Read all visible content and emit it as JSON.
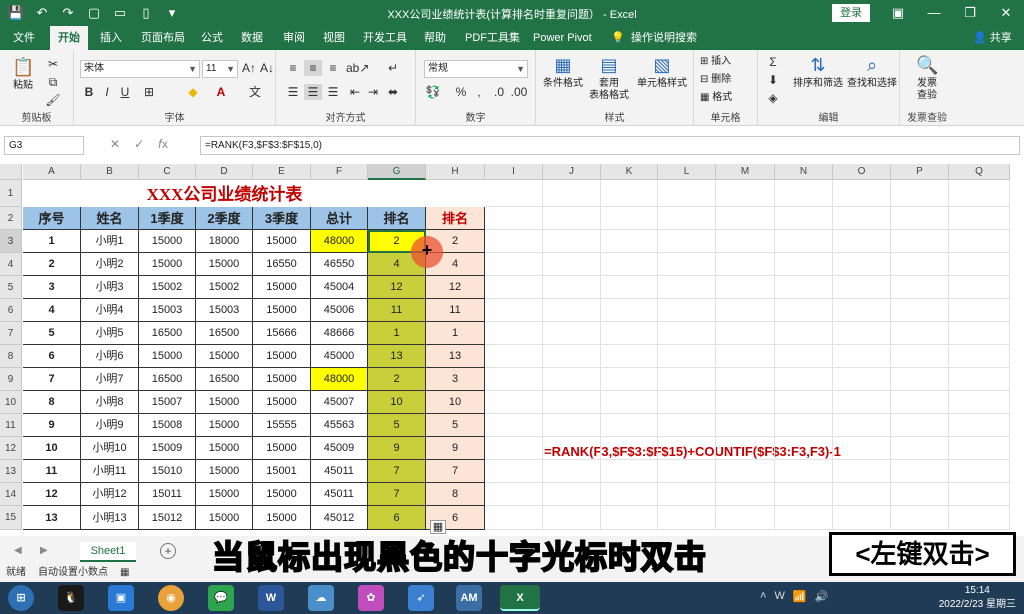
{
  "window": {
    "title": "XXX公司业绩统计表(计算排名时重复问题） - Excel",
    "login": "登录"
  },
  "tabs": [
    "文件",
    "开始",
    "插入",
    "页面布局",
    "公式",
    "数据",
    "审阅",
    "视图",
    "开发工具",
    "帮助",
    "PDF工具集",
    "Power Pivot",
    "操作说明搜索"
  ],
  "share": "共享",
  "ribbon": {
    "clipboard": {
      "paste": "粘贴",
      "label": "剪贴板"
    },
    "font": {
      "name": "宋体",
      "size": "11",
      "label": "字体"
    },
    "alignment": {
      "label": "对齐方式"
    },
    "number": {
      "format": "常规",
      "label": "数字"
    },
    "styles": {
      "cond": "条件格式",
      "table": "套用\n表格格式",
      "cell": "单元格样式",
      "label": "样式"
    },
    "cells": {
      "insert": "插入",
      "delete": "删除",
      "format": "格式",
      "label": "单元格"
    },
    "editing": {
      "sort": "排序和筛选",
      "find": "查找和选择",
      "label": "编辑"
    },
    "invoice": {
      "btn": "发票\n查验",
      "label": "发票查验"
    }
  },
  "formula_bar": {
    "name": "G3",
    "formula": "=RANK(F3,$F$3:$F$15,0)"
  },
  "columns": [
    "A",
    "B",
    "C",
    "D",
    "E",
    "F",
    "G",
    "H",
    "I",
    "J",
    "K",
    "L",
    "M",
    "N",
    "O",
    "P",
    "Q"
  ],
  "rows": [
    "1",
    "2",
    "3",
    "4",
    "5",
    "6",
    "7",
    "8",
    "9",
    "10",
    "11",
    "12",
    "13",
    "14",
    "15"
  ],
  "sheet_title": "XXX公司业绩统计表",
  "headers": [
    "序号",
    "姓名",
    "1季度",
    "2季度",
    "3季度",
    "总计",
    "排名",
    "排名"
  ],
  "data": [
    [
      "1",
      "小明1",
      "15000",
      "18000",
      "15000",
      "48000",
      "2",
      "2"
    ],
    [
      "2",
      "小明2",
      "15000",
      "15000",
      "16550",
      "46550",
      "4",
      "4"
    ],
    [
      "3",
      "小明3",
      "15002",
      "15002",
      "15000",
      "45004",
      "12",
      "12"
    ],
    [
      "4",
      "小明4",
      "15003",
      "15003",
      "15000",
      "45006",
      "11",
      "11"
    ],
    [
      "5",
      "小明5",
      "16500",
      "16500",
      "15666",
      "48666",
      "1",
      "1"
    ],
    [
      "6",
      "小明6",
      "15000",
      "15000",
      "15000",
      "45000",
      "13",
      "13"
    ],
    [
      "7",
      "小明7",
      "16500",
      "16500",
      "15000",
      "48000",
      "2",
      "3"
    ],
    [
      "8",
      "小明8",
      "15007",
      "15000",
      "15000",
      "45007",
      "10",
      "10"
    ],
    [
      "9",
      "小明9",
      "15008",
      "15000",
      "15555",
      "45563",
      "5",
      "5"
    ],
    [
      "10",
      "小明10",
      "15009",
      "15000",
      "15000",
      "45009",
      "9",
      "9"
    ],
    [
      "11",
      "小明11",
      "15010",
      "15000",
      "15001",
      "45011",
      "7",
      "7"
    ],
    [
      "12",
      "小明12",
      "15011",
      "15000",
      "15000",
      "45011",
      "7",
      "8"
    ],
    [
      "13",
      "小明13",
      "15012",
      "15000",
      "15000",
      "45012",
      "6",
      "6"
    ]
  ],
  "formula_note": "=RANK(F3,$F$3:$F$15)+COUNTIF($F$3:F3,F3)-1",
  "sheet_tab": "Sheet1",
  "status": {
    "ready": "就绪",
    "autodecimal": "自动设置小数点"
  },
  "subtitle": "当鼠标出现黑色的十字光标时双击",
  "key_hint": "<左键双击>",
  "clock": {
    "time": "15:14",
    "date": "2022/2/23 星期三"
  },
  "taskbar_icons": [
    "AM"
  ],
  "colors": {
    "excel_green": "#217346",
    "header_blue": "#9dc3e6",
    "highlight_yellow": "#ffff00",
    "rank_green": "#c9cf3a",
    "rank_peach": "#fce4d6",
    "title_red": "#c00000"
  }
}
